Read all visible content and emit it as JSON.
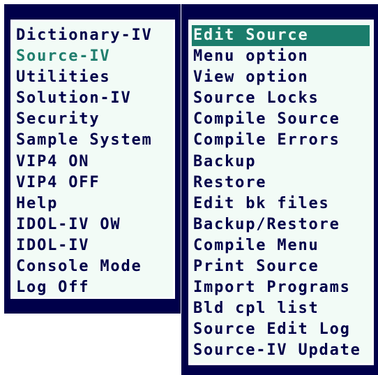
{
  "main_menu": {
    "items": [
      {
        "label": "Dictionary-IV"
      },
      {
        "label": "Source-IV"
      },
      {
        "label": "Utilities"
      },
      {
        "label": "Solution-IV"
      },
      {
        "label": "Security"
      },
      {
        "label": "Sample System"
      },
      {
        "label": "VIP4 ON"
      },
      {
        "label": "VIP4 OFF"
      },
      {
        "label": "Help"
      },
      {
        "label": "IDOL-IV OW"
      },
      {
        "label": "IDOL-IV"
      },
      {
        "label": "Console Mode"
      },
      {
        "label": "Log Off"
      }
    ],
    "current_item": "Source-IV"
  },
  "sub_menu": {
    "items": [
      {
        "label": "Edit Source"
      },
      {
        "label": "Menu option"
      },
      {
        "label": "View option"
      },
      {
        "label": "Source Locks"
      },
      {
        "label": "Compile Source"
      },
      {
        "label": "Compile Errors"
      },
      {
        "label": "Backup"
      },
      {
        "label": "Restore"
      },
      {
        "label": "Edit bk files"
      },
      {
        "label": "Backup/Restore"
      },
      {
        "label": "Compile Menu"
      },
      {
        "label": "Print Source"
      },
      {
        "label": "Import Programs"
      },
      {
        "label": "Bld cpl list"
      },
      {
        "label": "Source Edit Log"
      },
      {
        "label": "Source-IV Update"
      }
    ],
    "selected_item": "Edit Source"
  },
  "colors": {
    "frame": "#00004a",
    "panel": "#f2fbf6",
    "text": "#00004a",
    "highlight": "#1b7d6c",
    "current_text": "#207e6e"
  }
}
